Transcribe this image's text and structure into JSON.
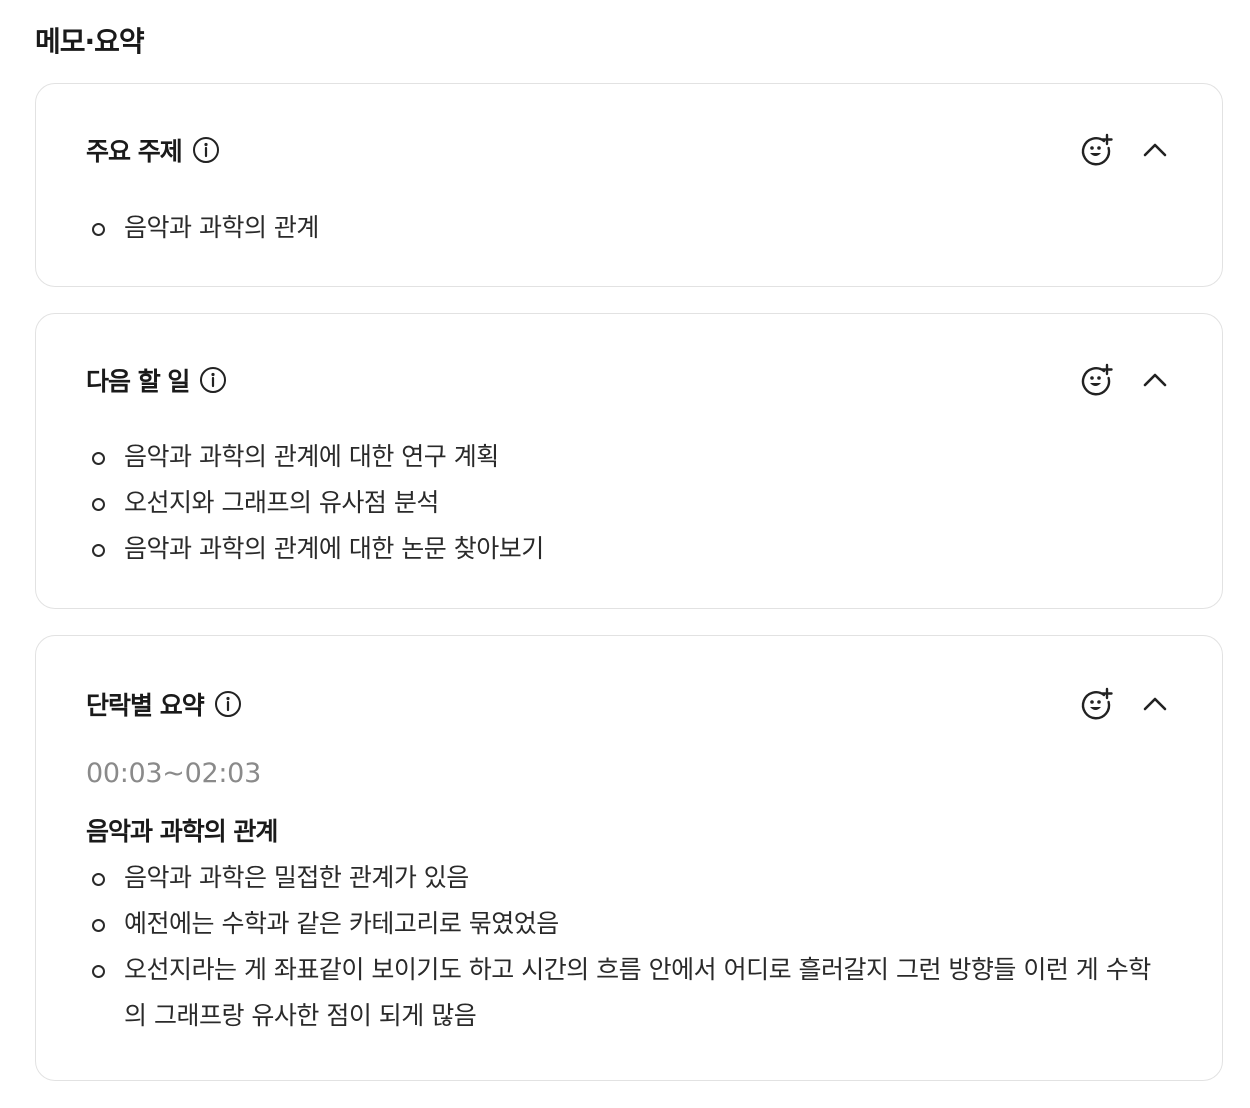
{
  "page": {
    "title": "메모·요약"
  },
  "cards": [
    {
      "title": "주요 주제",
      "items": [
        "음악과 과학의 관계"
      ]
    },
    {
      "title": "다음 할 일",
      "items": [
        "음악과 과학의 관계에 대한 연구 계획",
        "오선지와 그래프의 유사점 분석",
        "음악과 과학의 관계에 대한 논문 찾아보기"
      ]
    },
    {
      "title": "단락별 요약",
      "time_range": "00:03~02:03",
      "heading": "음악과 과학의 관계",
      "items": [
        "음악과 과학은 밀접한 관계가 있음",
        "예전에는 수학과 같은 카테고리로 묶였었음",
        "오선지라는 게 좌표같이 보이기도 하고 시간의 흐름 안에서 어디로 흘러갈지 그런 방향들 이런 게 수학의 그래프랑 유사한 점이 되게 많음"
      ]
    }
  ],
  "icons": {
    "info": "info-icon",
    "reaction": "add-emoji-reaction-icon",
    "collapse": "chevron-up-icon"
  },
  "colors": {
    "text": "#1a1a1a",
    "muted": "#8a8a8a",
    "border": "#e2e2e2"
  }
}
